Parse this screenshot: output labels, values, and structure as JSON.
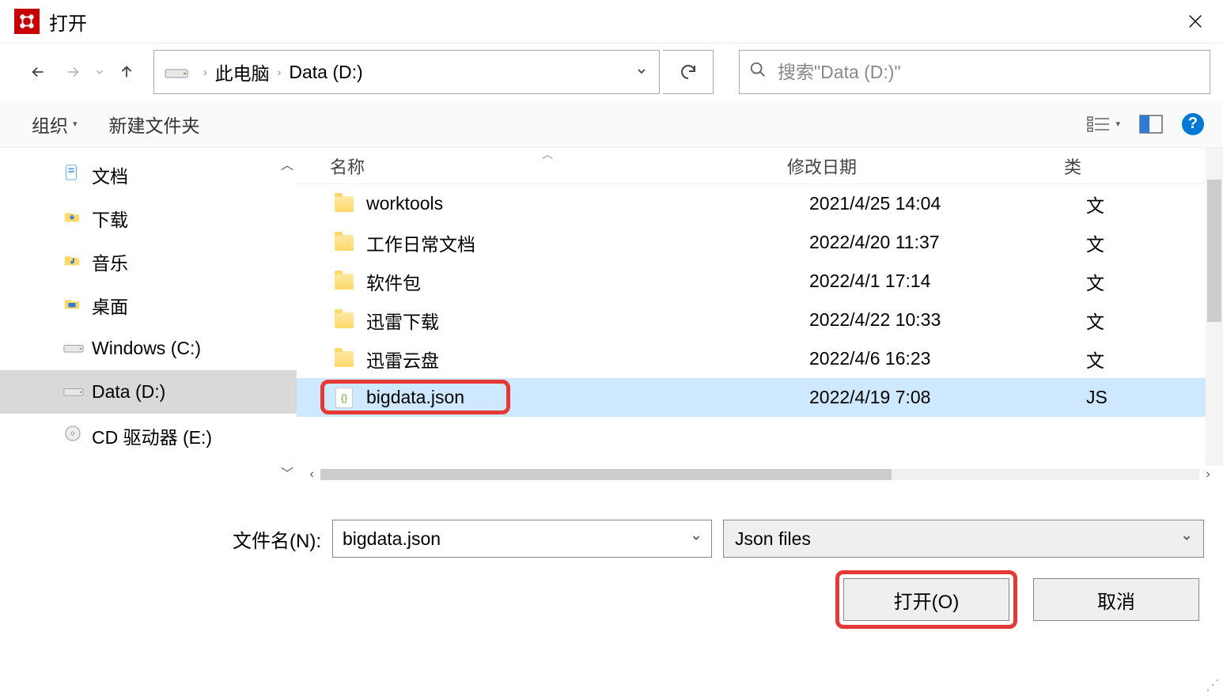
{
  "title": "打开",
  "breadcrumb": {
    "root": "此电脑",
    "current": "Data (D:)"
  },
  "search": {
    "placeholder": "搜索\"Data (D:)\""
  },
  "toolbar": {
    "organize": "组织",
    "new_folder": "新建文件夹"
  },
  "sidebar": {
    "items": [
      {
        "label": "文档",
        "icon": "documents"
      },
      {
        "label": "下载",
        "icon": "downloads"
      },
      {
        "label": "音乐",
        "icon": "music"
      },
      {
        "label": "桌面",
        "icon": "desktop"
      },
      {
        "label": "Windows (C:)",
        "icon": "drive"
      },
      {
        "label": "Data (D:)",
        "icon": "drive",
        "selected": true
      },
      {
        "label": "CD 驱动器 (E:)",
        "icon": "cd"
      }
    ]
  },
  "columns": {
    "name": "名称",
    "date": "修改日期",
    "type": "类"
  },
  "files": [
    {
      "name": "worktools",
      "date": "2021/4/25 14:04",
      "type": "文",
      "kind": "folder"
    },
    {
      "name": "工作日常文档",
      "date": "2022/4/20 11:37",
      "type": "文",
      "kind": "folder"
    },
    {
      "name": "软件包",
      "date": "2022/4/1 17:14",
      "type": "文",
      "kind": "folder"
    },
    {
      "name": "迅雷下载",
      "date": "2022/4/22 10:33",
      "type": "文",
      "kind": "folder"
    },
    {
      "name": "迅雷云盘",
      "date": "2022/4/6 16:23",
      "type": "文",
      "kind": "folder"
    },
    {
      "name": "bigdata.json",
      "date": "2022/4/19 7:08",
      "type": "JS",
      "kind": "json",
      "selected": true,
      "highlighted": true
    }
  ],
  "filename": {
    "label": "文件名(N):",
    "value": "bigdata.json"
  },
  "filetype": {
    "value": "Json files"
  },
  "buttons": {
    "open": "打开(O)",
    "cancel": "取消"
  }
}
